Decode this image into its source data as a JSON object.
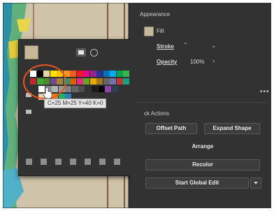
{
  "colors": {
    "fill": "#c8b89a",
    "highlight": "#e8551d",
    "panel_bg": "#323232"
  },
  "popup": {
    "tooltip": "C=25 M=25 Y=40 K=0",
    "icons": [
      "swatches-tab-icon",
      "color-picker-tab-icon"
    ],
    "bottom_icons": [
      "swatch-library-icon",
      "show-kinds-icon",
      "swatch-options-icon",
      "color-group-icon",
      "new-group-icon",
      "new-swatch-icon",
      "delete-swatch-icon"
    ],
    "swatch_rows": [
      [
        "#ffffff",
        "#000000",
        "#e6d4a8",
        "#ffe100",
        "#ffc200",
        "#f7941d",
        "#f15a24",
        "#ed1c24",
        "#ec008c",
        "#92278f",
        "#2e3192",
        "#0072bc",
        "#00aeef",
        "#00a651",
        "#39b54a",
        "#8dc63f"
      ],
      [
        "#c1272d",
        "#3fa535",
        "#4d8a2a",
        "#6a4c93",
        "#b07f33",
        "#1b9e77",
        "#d95f02",
        "#e7298a",
        "#66a61e",
        "#e6ab02",
        "#a6761d",
        "#666666",
        "#7570b3",
        "#c0392b",
        "#16a085",
        "#f39c12"
      ],
      [
        "#ffffff",
        "#8c8c8c",
        "#b3b3b3",
        "#999999",
        "#808080",
        "#666666",
        "#4d4d4d",
        "#333333",
        "#1a1a1a",
        "#000000",
        "#8e44ad",
        "#2c3e50"
      ],
      [
        "#e6d4a8",
        "#f1c40f",
        "#e67e22",
        "#27ae60",
        "#2980b9"
      ]
    ]
  },
  "panel": {
    "appearance_title": "Appearance",
    "fill_label": "Fill",
    "stroke_label": "Stroke",
    "opacity_label": "Opacity",
    "opacity_value": "100%",
    "quick_actions_title": "ck Actions",
    "offset_path": "Offset Path",
    "expand_shape": "Expand Shape",
    "arrange": "Arrange",
    "recolor": "Recolor",
    "start_global_edit": "Start Global Edit",
    "more": "•••"
  }
}
